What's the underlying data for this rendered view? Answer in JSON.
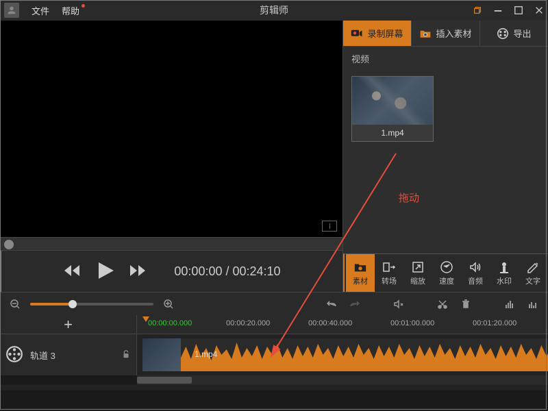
{
  "titlebar": {
    "menu_file": "文件",
    "menu_help": "帮助",
    "app_title": "剪辑师"
  },
  "actions": {
    "record": "录制屏幕",
    "import": "插入素材",
    "export": "导出"
  },
  "panel": {
    "video_label": "视频"
  },
  "asset": {
    "name": "1.mp4"
  },
  "hint": {
    "drag": "拖动"
  },
  "transport": {
    "time_current": "00:00:00",
    "time_sep": " / ",
    "time_total": "00:24:10"
  },
  "tabs": {
    "material": "素材",
    "transition": "转场",
    "scale": "缩放",
    "speed": "速度",
    "audio": "音频",
    "watermark": "水印",
    "text": "文字"
  },
  "ruler": {
    "t0": "00:00:00.000",
    "t1": "00:00:20.000",
    "t2": "00:00:40.000",
    "t3": "00:01:00.000",
    "t4": "00:01:20.000"
  },
  "track": {
    "label": "轨道 3",
    "clip_name": "1.mp4"
  }
}
